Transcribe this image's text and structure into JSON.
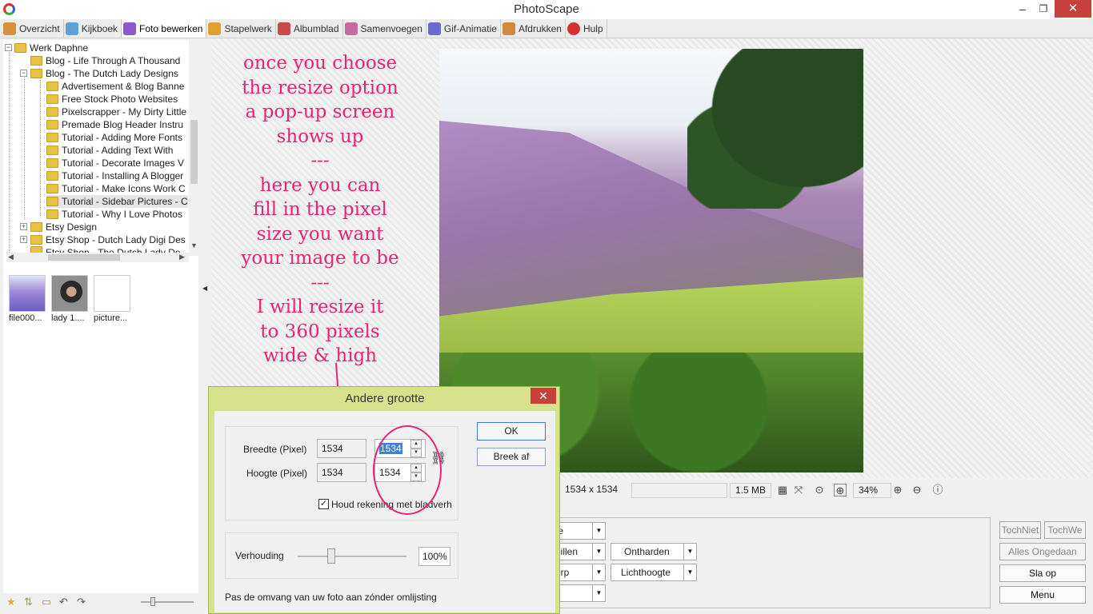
{
  "window": {
    "title": "PhotoScape",
    "minimize": "–",
    "maximize": "❐",
    "close": "✕"
  },
  "tabs": [
    {
      "label": "Overzicht",
      "color": "#d7913b"
    },
    {
      "label": "Kijkboek",
      "color": "#5aa2d8"
    },
    {
      "label": "Foto bewerken",
      "color": "#8a5ac8"
    },
    {
      "label": "Stapelwerk",
      "color": "#e0a030"
    },
    {
      "label": "Albumblad",
      "color": "#c84a4a"
    },
    {
      "label": "Samenvoegen",
      "color": "#c86aa0"
    },
    {
      "label": "Gif-Animatie",
      "color": "#6a6ad0"
    },
    {
      "label": "Afdrukken",
      "color": "#d08a3a"
    },
    {
      "label": "Hulp",
      "color": "#d63030"
    }
  ],
  "tree": {
    "root": "Werk Daphne",
    "items": [
      "Blog - Life Through A Thousand",
      "Blog - The Dutch Lady Designs",
      "Advertisement & Blog Banne",
      "Free Stock Photo Websites",
      "Pixelscrapper - My Dirty Little",
      "Premade Blog Header Instru",
      "Tutorial - Adding More Fonts",
      "Tutorial - Adding Text With",
      "Tutorial - Decorate Images V",
      "Tutorial - Installing A Blogger",
      "Tutorial - Make Icons Work C",
      "Tutorial - Sidebar Pictures - C",
      "Tutorial - Why I Love Photos",
      "Etsy Design",
      "Etsy Shop - Dutch Lady Digi Des",
      "Etsy Shop - The Dutch Lady De"
    ]
  },
  "thumbnails": [
    {
      "label": "file000..."
    },
    {
      "label": "lady 1...."
    },
    {
      "label": "picture..."
    }
  ],
  "note": {
    "lines": [
      "once you choose",
      "the resize option",
      "a pop-up screen",
      "shows up",
      "---",
      "here you can",
      "fill in the pixel",
      "size you want",
      "your image to be",
      "---",
      "I will resize it",
      "to 360 pixels",
      "wide & high"
    ],
    "color": "#e8237a"
  },
  "status": {
    "dimensions": "1534 x 1534",
    "filesize": "1.5 MB",
    "zoom": "34%"
  },
  "editpanel": {
    "combo1": "te",
    "combo2": "hillen",
    "combo3": "erp",
    "combo4": "",
    "ontharden": "Ontharden",
    "lichthoogte": "Lichthoogte"
  },
  "right_buttons": {
    "tochniet": "TochNiet",
    "tochwe": "TochWe",
    "alles_ongedaan": "Alles Ongedaan",
    "sla_op": "Sla op",
    "menu": "Menu"
  },
  "dialog": {
    "title": "Andere grootte",
    "close": "✕",
    "width_label": "Breedte (Pixel)",
    "height_label": "Hoogte (Pixel)",
    "width_orig": "1534",
    "width_new": "1534",
    "height_orig": "1534",
    "height_new": "1534",
    "keep_ratio_label": "Houd rekening met bladverh",
    "keep_ratio_checked": true,
    "ok": "OK",
    "cancel": "Breek af",
    "ratio_label": "Verhouding",
    "ratio_value": "100%",
    "ratio_slider_fraction": 0.31,
    "footer": "Pas de omvang van uw foto aan zónder omlijsting"
  }
}
